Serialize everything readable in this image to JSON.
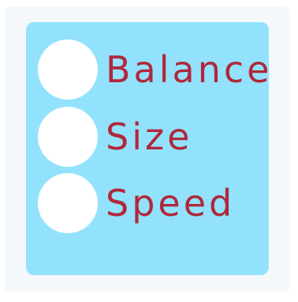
{
  "options": [
    {
      "label": "Balance",
      "selected": false
    },
    {
      "label": "Size",
      "selected": false
    },
    {
      "label": "Speed",
      "selected": false
    }
  ],
  "colors": {
    "panel_background": "#93e2fd",
    "label_text": "#b0283a",
    "radio_fill": "#ffffff"
  }
}
